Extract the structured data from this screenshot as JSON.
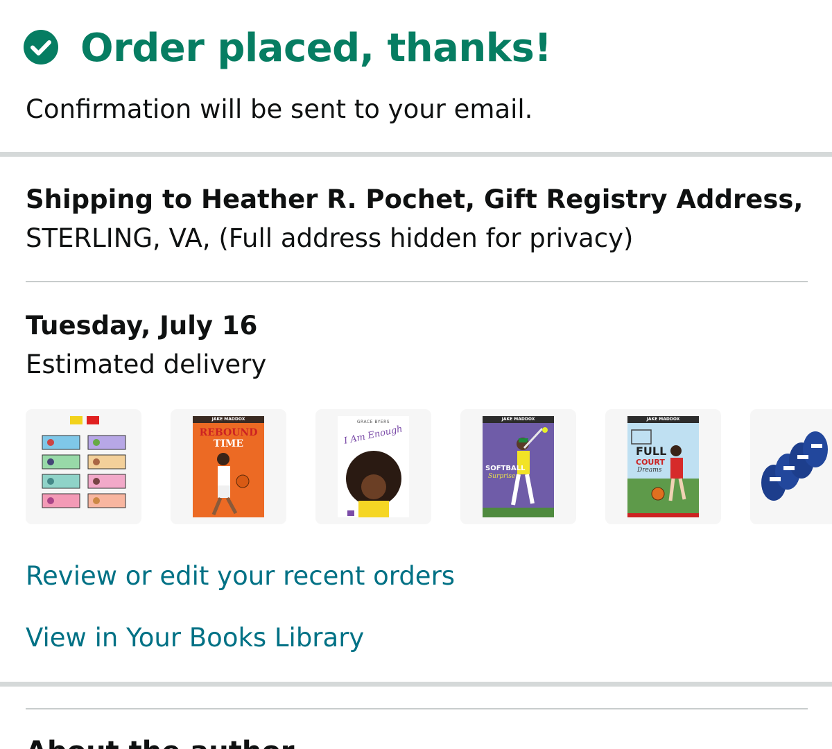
{
  "confirmation": {
    "title": "Order placed, thanks!",
    "subtitle": "Confirmation will be sent to your email."
  },
  "shipping": {
    "line1": "Shipping to Heather R. Pochet, Gift Registry Address,",
    "line2": "STERLING, VA, (Full address hidden for privacy)"
  },
  "delivery": {
    "date": "Tuesday, July 16",
    "label": "Estimated delivery"
  },
  "items": [
    {
      "icon": "emotion-flash-cards-product-image"
    },
    {
      "author_band": "JAKE MADDOX",
      "title_line1": "REBOUND",
      "title_line2": "TIME"
    },
    {
      "author": "GRACE BYERS",
      "title": "I Am Enough"
    },
    {
      "author_band": "JAKE MADDOX",
      "title_line1": "SOFTBALL",
      "title_line2": "Surprise"
    },
    {
      "author_band": "JAKE MADDOX",
      "title_line1": "FULL",
      "title_line2": "COURT",
      "title_line3": "Dreams"
    },
    {
      "icon": "label-tape-cartridges-product-image"
    }
  ],
  "links": {
    "review_orders": "Review or edit your recent orders",
    "books_library": "View in Your Books Library"
  },
  "next_section": {
    "heading": "About the author"
  },
  "colors": {
    "success_green": "#067d62",
    "link_teal": "#007185",
    "divider": "#d5d9d9"
  }
}
